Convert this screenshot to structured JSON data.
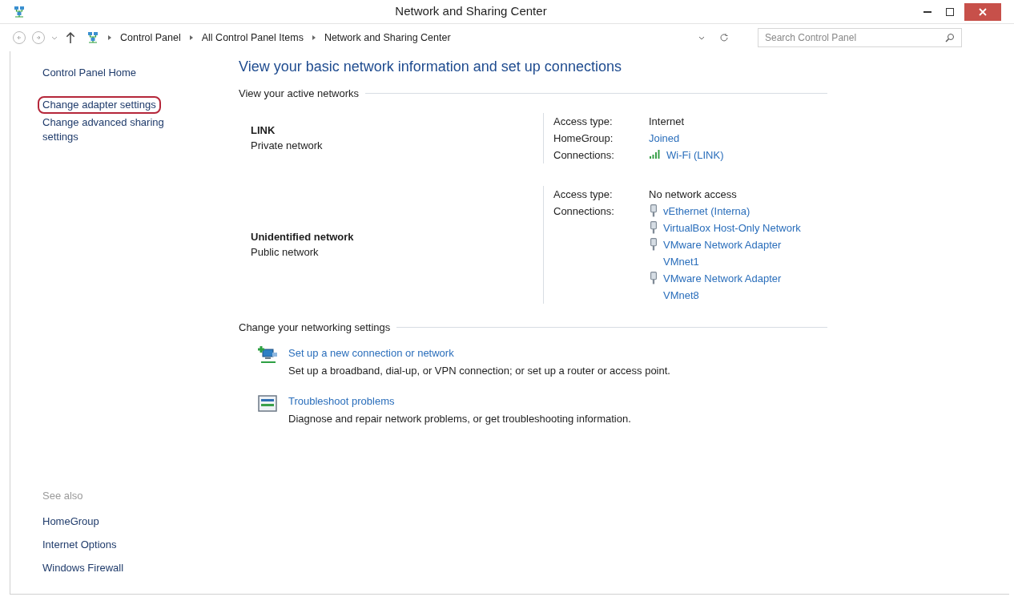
{
  "window": {
    "title": "Network and Sharing Center"
  },
  "address_bar": {
    "breadcrumbs": [
      "Control Panel",
      "All Control Panel Items",
      "Network and Sharing Center"
    ],
    "search_placeholder": "Search Control Panel"
  },
  "sidebar": {
    "items": [
      {
        "label": "Control Panel Home",
        "highlighted": false
      },
      {
        "label": "Change adapter settings",
        "highlighted": true
      },
      {
        "label": "Change advanced sharing settings",
        "highlighted": false
      }
    ],
    "see_also": {
      "heading": "See also",
      "links": [
        "HomeGroup",
        "Internet Options",
        "Windows Firewall"
      ]
    }
  },
  "main": {
    "title": "View your basic network information and set up connections",
    "active_networks": {
      "heading": "View your active networks",
      "networks": [
        {
          "name": "LINK",
          "category": "Private network",
          "details": [
            {
              "label": "Access type:",
              "value": "Internet",
              "kind": "text"
            },
            {
              "label": "HomeGroup:",
              "value": "Joined",
              "kind": "link"
            },
            {
              "label": "Connections:",
              "kind": "connections",
              "connections": [
                {
                  "kind": "wifi",
                  "label": "Wi-Fi (LINK)"
                }
              ]
            }
          ]
        },
        {
          "name": "Unidentified network",
          "category": "Public network",
          "details": [
            {
              "label": "Access type:",
              "value": "No network access",
              "kind": "text"
            },
            {
              "label": "Connections:",
              "kind": "connections",
              "connections": [
                {
                  "kind": "ethernet",
                  "label": "vEthernet (Interna)"
                },
                {
                  "kind": "ethernet",
                  "label": "VirtualBox Host-Only Network"
                },
                {
                  "kind": "ethernet",
                  "label": "VMware Network Adapter VMnet1"
                },
                {
                  "kind": "ethernet",
                  "label": "VMware Network Adapter VMnet8"
                }
              ]
            }
          ]
        }
      ]
    },
    "settings": {
      "heading": "Change your networking settings",
      "tasks": [
        {
          "kind": "new_connection",
          "link": "Set up a new connection or network",
          "description": "Set up a broadband, dial-up, or VPN connection; or set up a router or access point."
        },
        {
          "kind": "troubleshoot",
          "link": "Troubleshoot problems",
          "description": "Diagnose and repair network problems, or get troubleshooting information."
        }
      ]
    }
  }
}
